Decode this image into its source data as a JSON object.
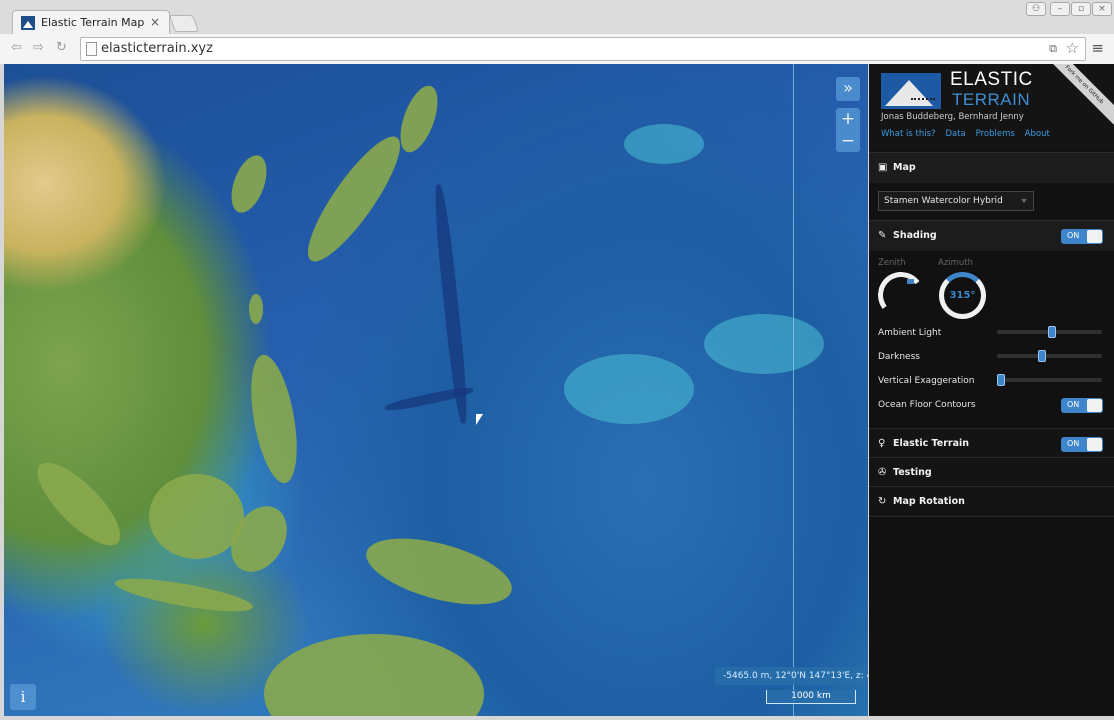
{
  "browser": {
    "tab_title": "Elastic Terrain Map",
    "tab_close": "×",
    "url": "elasticterrain.xyz"
  },
  "map": {
    "collapse_button": "»",
    "zoom_in": "+",
    "zoom_out": "−",
    "coords": "-5465.0 m, 12°0'N 147°13'E, z: 4",
    "scale": "1000 km",
    "info_button": "i"
  },
  "panel": {
    "logo_line1": "ELASTIC",
    "logo_line2": "TERRAIN",
    "authors": "Jonas Buddeberg, Bernhard Jenny",
    "links": [
      "What is this?",
      "Data",
      "Problems",
      "About"
    ],
    "ribbon": "Fork me on GitHub",
    "sections": {
      "map": {
        "label": "Map",
        "icon": "image-icon"
      },
      "shading": {
        "label": "Shading",
        "icon": "brush-icon",
        "toggle": "ON"
      },
      "elastic": {
        "label": "Elastic Terrain",
        "icon": "bulb-icon",
        "toggle": "ON"
      },
      "testing": {
        "label": "Testing",
        "icon": "wrench-icon"
      },
      "rotation": {
        "label": "Map Rotation",
        "icon": "refresh-icon"
      }
    },
    "map_select": "Stamen Watercolor Hybrid",
    "zenith_label": "Zenith",
    "azimuth_label": "Azimuth",
    "azimuth_value": "315°",
    "sliders": {
      "ambient_label": "Ambient Light",
      "ambient_value": 0.53,
      "darkness_label": "Darkness",
      "darkness_value": 0.42,
      "exaggeration_label": "Vertical Exaggeration",
      "exaggeration_value": 0.0
    },
    "contours_label": "Ocean Floor Contours",
    "contours_toggle": "ON",
    "accent": "#3e86c9"
  }
}
